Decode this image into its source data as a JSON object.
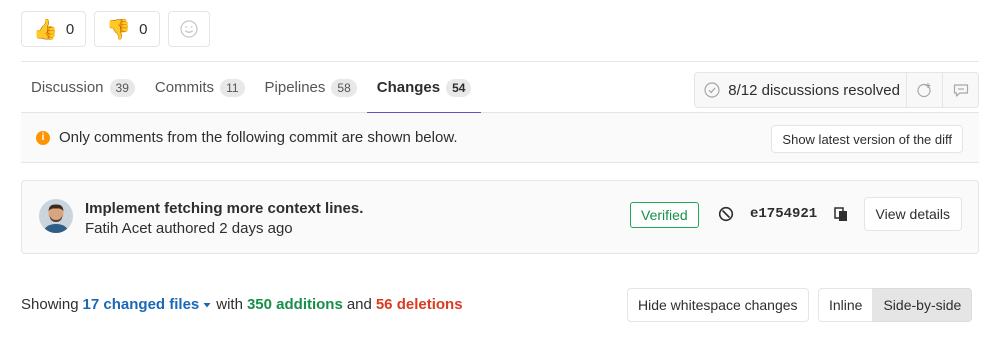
{
  "awards": {
    "thumbsup": {
      "emoji": "👍",
      "count": "0"
    },
    "thumbsdown": {
      "emoji": "👎",
      "count": "0"
    }
  },
  "tabs": [
    {
      "label": "Discussion",
      "count": "39"
    },
    {
      "label": "Commits",
      "count": "11"
    },
    {
      "label": "Pipelines",
      "count": "58"
    },
    {
      "label": "Changes",
      "count": "54"
    }
  ],
  "resolve": {
    "status": "8/12 discussions resolved"
  },
  "info_bar": {
    "message": "Only comments from the following commit are shown below.",
    "button": "Show latest version of the diff"
  },
  "commit": {
    "title": "Implement fetching more context lines.",
    "author": "Fatih Acet",
    "authored_text": "authored 2 days ago",
    "verified": "Verified",
    "sha": "e1754921",
    "view_details": "View details"
  },
  "summary": {
    "showing": "Showing",
    "files": "17 changed files",
    "with": "with",
    "additions": "350 additions",
    "and": "and",
    "deletions": "56 deletions"
  },
  "diff_controls": {
    "whitespace": "Hide whitespace changes",
    "inline": "Inline",
    "side_by_side": "Side-by-side"
  },
  "colors": {
    "active_tab": "#6b4fbb",
    "link": "#1b69b6",
    "additions": "#168f48",
    "deletions": "#db3b21",
    "warning": "#fc9403"
  }
}
